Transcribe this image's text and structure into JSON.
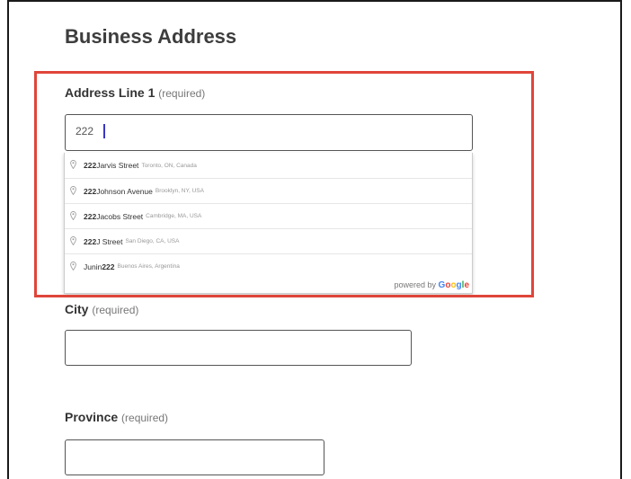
{
  "form": {
    "title": "Business Address",
    "required_text": "(required)",
    "address_line1": {
      "label": "Address Line 1",
      "value": "222"
    },
    "city": {
      "label": "City",
      "value": ""
    },
    "province": {
      "label": "Province",
      "value": ""
    }
  },
  "autocomplete": {
    "suggestions": [
      {
        "pre": "",
        "match": "222",
        "rest": " Jarvis Street",
        "secondary": "Toronto, ON, Canada"
      },
      {
        "pre": "",
        "match": "222",
        "rest": " Johnson Avenue",
        "secondary": "Brooklyn, NY, USA"
      },
      {
        "pre": "",
        "match": "222",
        "rest": " Jacobs Street",
        "secondary": "Cambridge, MA, USA"
      },
      {
        "pre": "",
        "match": "222",
        "rest": " J Street",
        "secondary": "San Diego, CA, USA"
      },
      {
        "pre": "Junin ",
        "match": "222",
        "rest": "",
        "secondary": "Buenos Aires, Argentina"
      }
    ],
    "powered_by": "powered by",
    "brand": "Google"
  },
  "colors": {
    "highlight": "#e0453a",
    "caret": "#3a36c4",
    "google": [
      "#4285F4",
      "#EA4335",
      "#FBBC05",
      "#4285F4",
      "#34A853",
      "#EA4335"
    ]
  },
  "icons": {
    "suggestion_marker": "map-pin-icon"
  }
}
